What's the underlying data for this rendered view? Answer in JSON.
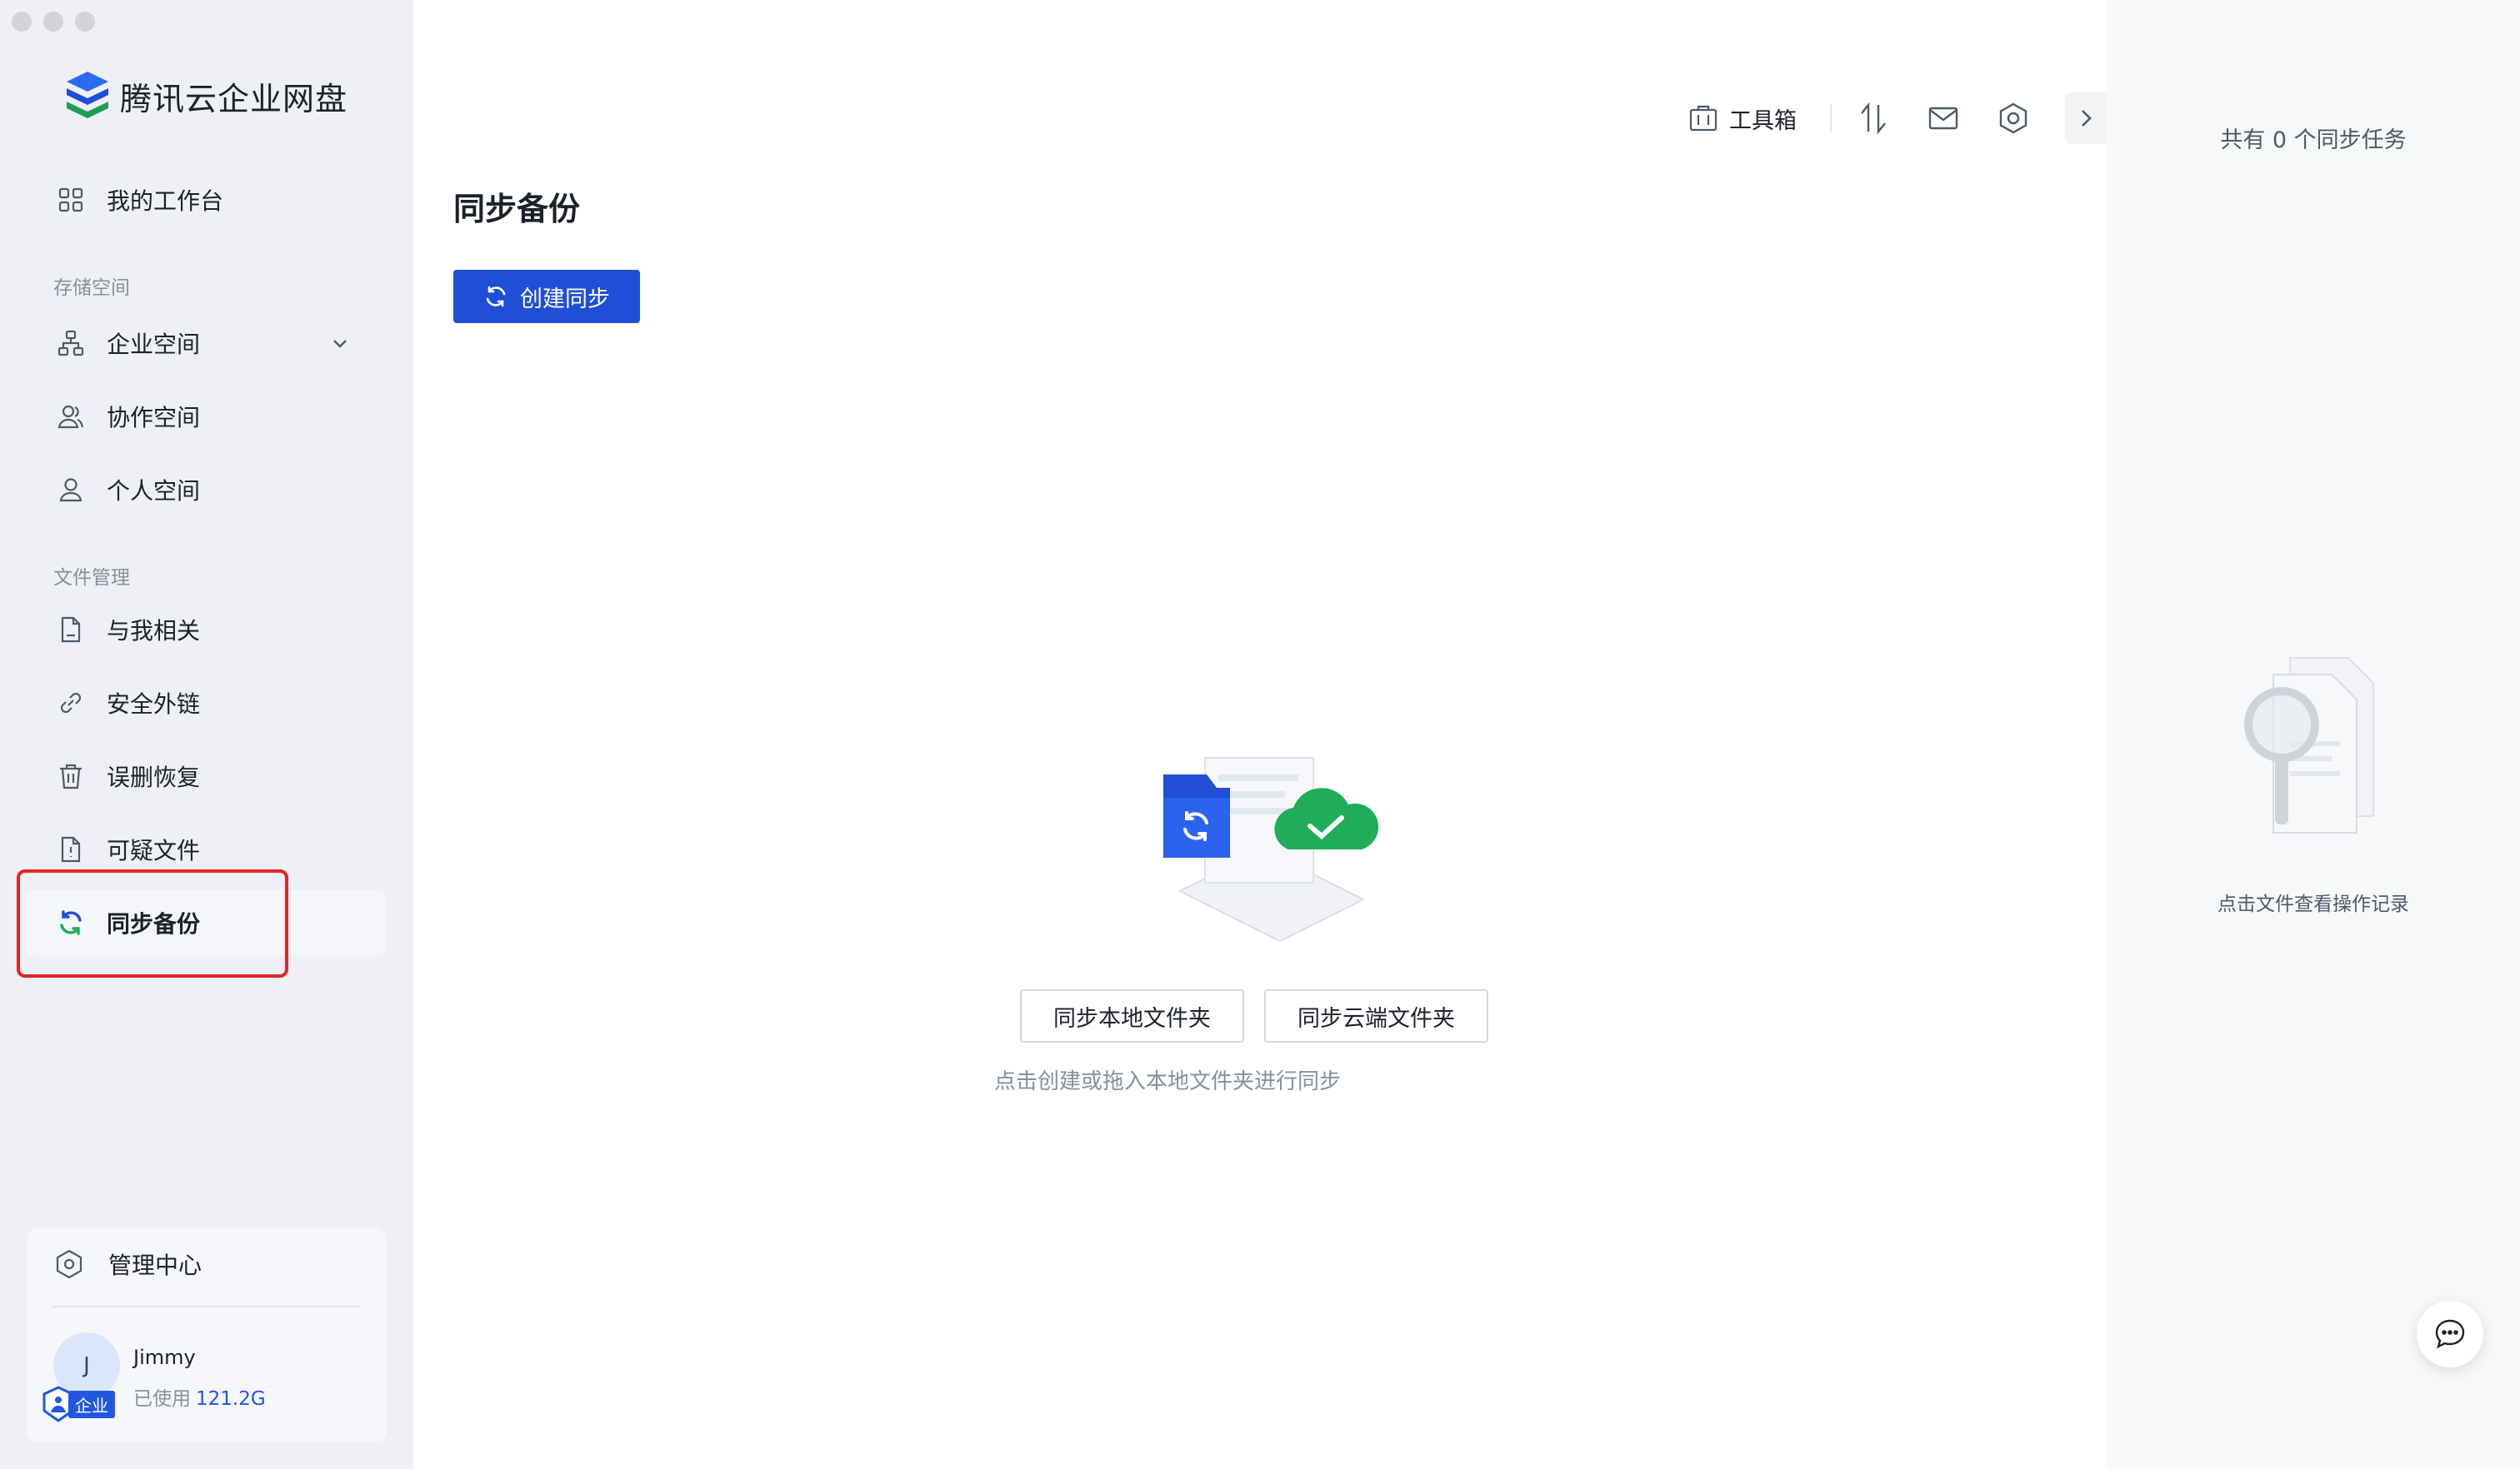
{
  "app": {
    "brand": "腾讯云企业网盘"
  },
  "sidebar": {
    "workspace": "我的工作台",
    "storage_label": "存储空间",
    "enterprise_space": "企业空间",
    "collab_space": "协作空间",
    "personal_space": "个人空间",
    "file_mgmt_label": "文件管理",
    "related": "与我相关",
    "secure_link": "安全外链",
    "recovery": "误删恢复",
    "suspicious": "可疑文件",
    "sync_backup": "同步备份",
    "admin_center": "管理中心",
    "user": {
      "initial": "J",
      "name": "Jimmy",
      "badge": "企业",
      "usage_label": "已使用",
      "usage_value": "121.2G"
    }
  },
  "toolbar": {
    "toolbox_label": "工具箱"
  },
  "main": {
    "title": "同步备份",
    "create_label": "创建同步",
    "sync_local": "同步本地文件夹",
    "sync_cloud": "同步云端文件夹",
    "hint": "点击创建或拖入本地文件夹进行同步"
  },
  "right_panel": {
    "task_count": "共有 0 个同步任务",
    "empty_text": "点击文件查看操作记录"
  },
  "colors": {
    "accent": "#1f4fd6",
    "success": "#1fad5a",
    "highlight": "#e62424",
    "sidebar_bg": "#eef0f6"
  }
}
